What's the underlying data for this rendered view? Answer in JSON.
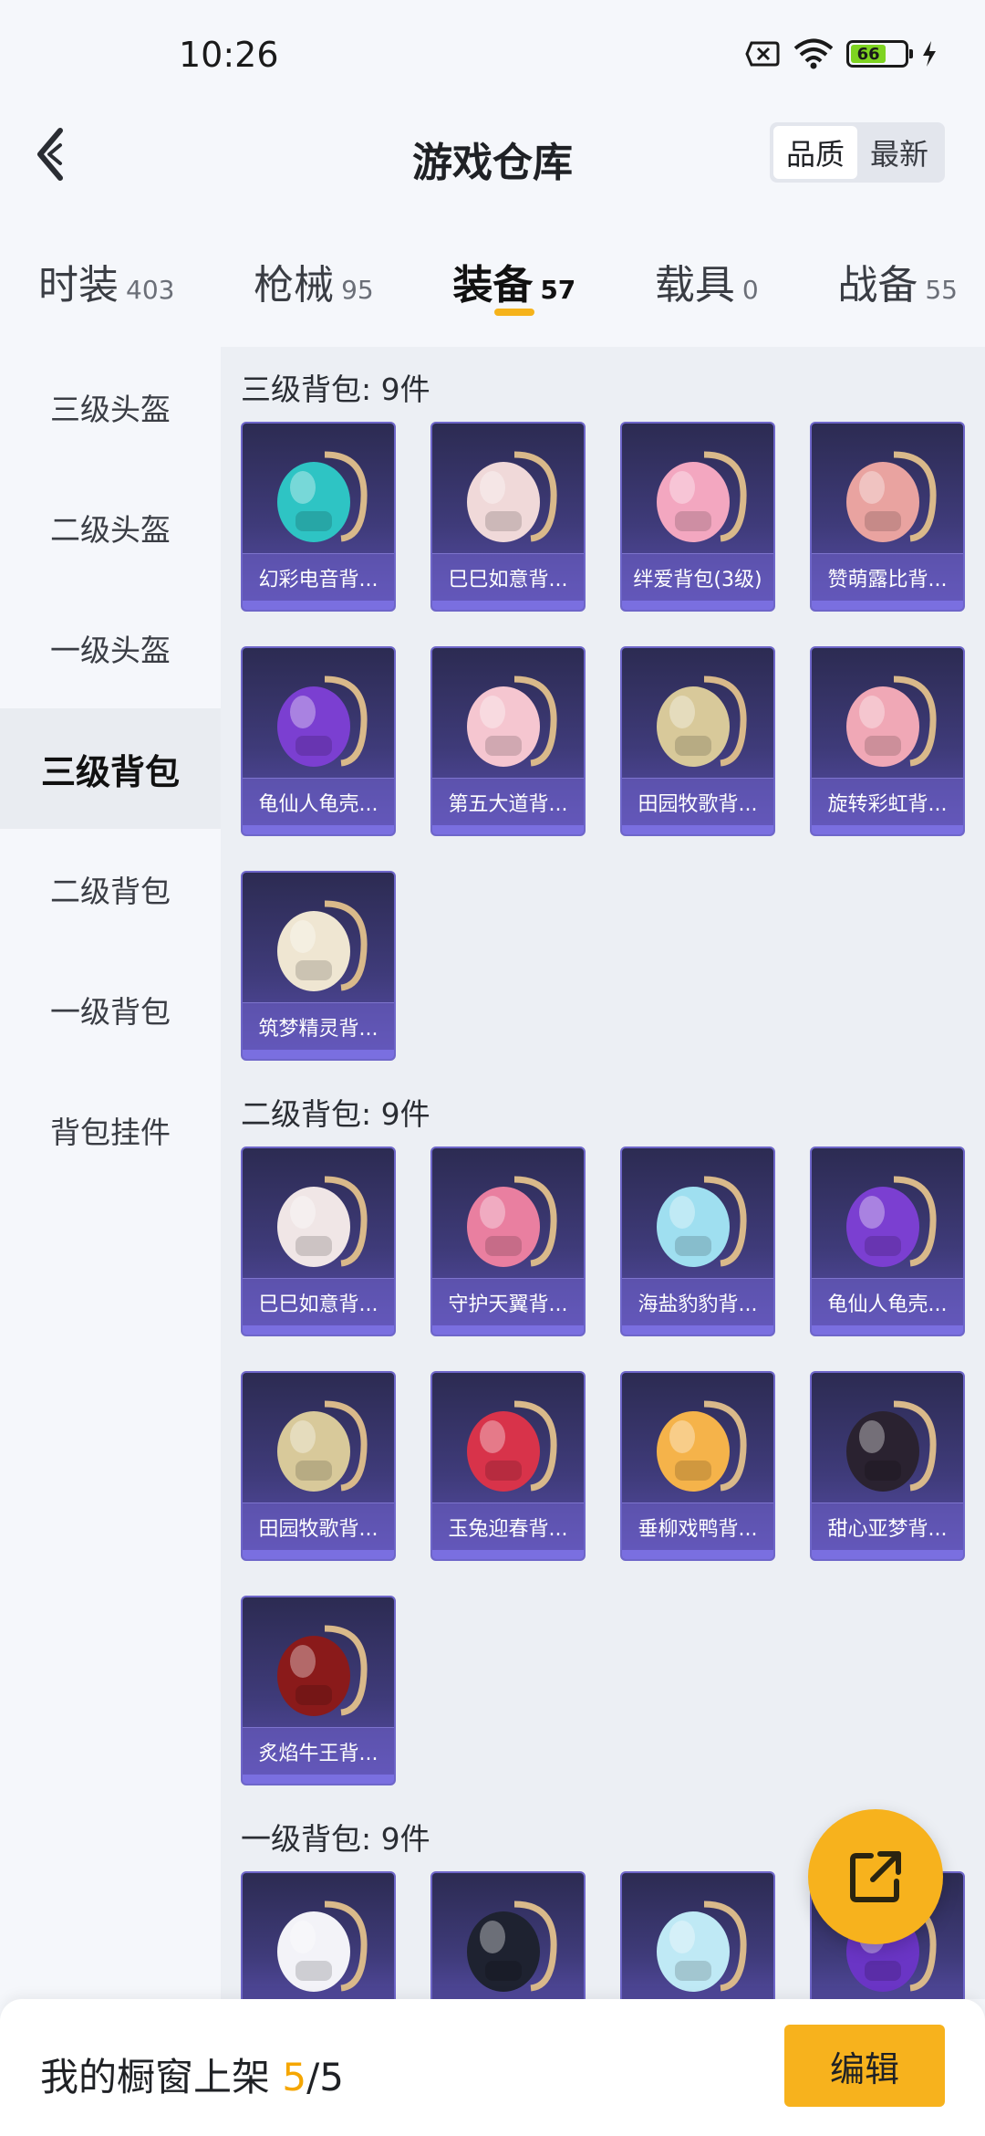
{
  "status_bar": {
    "time": "10:26",
    "battery": "66"
  },
  "header": {
    "title": "游戏仓库",
    "sort_options": [
      "品质",
      "最新"
    ],
    "active_sort": "品质"
  },
  "tabs": [
    {
      "label": "时装",
      "count": "403"
    },
    {
      "label": "枪械",
      "count": "95"
    },
    {
      "label": "装备",
      "count": "57",
      "active": true
    },
    {
      "label": "载具",
      "count": "0"
    },
    {
      "label": "战备",
      "count": "55"
    }
  ],
  "sidebar": {
    "items": [
      "三级头盔",
      "二级头盔",
      "一级头盔",
      "三级背包",
      "二级背包",
      "一级背包",
      "背包挂件"
    ],
    "active": "三级背包"
  },
  "sections": [
    {
      "title": "三级背包: 9件",
      "items": [
        {
          "name": "幻彩电音背...",
          "icon": "rainbow-music-backpack-icon",
          "color": "#2ec4c4"
        },
        {
          "name": "巳巳如意背...",
          "icon": "snake-backpack-icon",
          "color": "#f0d9d9"
        },
        {
          "name": "绊爱背包(3级)",
          "icon": "heart-backpack-icon",
          "color": "#f3a7c0"
        },
        {
          "name": "赞萌露比背...",
          "icon": "pink-bear-backpack-icon",
          "color": "#e9a3a0"
        },
        {
          "name": "龟仙人龟壳...",
          "icon": "turtle-shell-backpack-icon",
          "color": "#7b3fd1"
        },
        {
          "name": "第五大道背...",
          "icon": "quilted-bag-icon",
          "color": "#f5c6d0"
        },
        {
          "name": "田园牧歌背...",
          "icon": "flower-basket-backpack-icon",
          "color": "#d8c99a"
        },
        {
          "name": "旋转彩虹背...",
          "icon": "carousel-backpack-icon",
          "color": "#f0a8b6"
        },
        {
          "name": "筑梦精灵背...",
          "icon": "fairy-wings-backpack-icon",
          "color": "#efe6d2"
        }
      ]
    },
    {
      "title": "二级背包: 9件",
      "items": [
        {
          "name": "巳巳如意背...",
          "icon": "snake-backpack-icon",
          "color": "#f0e6e6"
        },
        {
          "name": "守护天翼背...",
          "icon": "pink-winged-backpack-icon",
          "color": "#e97fa0"
        },
        {
          "name": "海盐豹豹背...",
          "icon": "seal-backpack-icon",
          "color": "#9fdff0"
        },
        {
          "name": "龟仙人龟壳...",
          "icon": "turtle-shell-backpack-icon",
          "color": "#7b3fd1"
        },
        {
          "name": "田园牧歌背...",
          "icon": "flower-basket-backpack-icon",
          "color": "#d8c99a"
        },
        {
          "name": "玉兔迎春背...",
          "icon": "red-rabbit-backpack-icon",
          "color": "#d8334a"
        },
        {
          "name": "垂柳戏鸭背...",
          "icon": "duck-backpack-icon",
          "color": "#f5b34a"
        },
        {
          "name": "甜心亚梦背...",
          "icon": "black-heart-backpack-icon",
          "color": "#2a2230"
        },
        {
          "name": "炙焰牛王背...",
          "icon": "flame-bull-backpack-icon",
          "color": "#8a1a1a"
        }
      ]
    },
    {
      "title": "一级背包: 9件",
      "items": [
        {
          "name": "",
          "icon": "white-bunny-backpack-icon",
          "color": "#f3f3f8"
        },
        {
          "name": "",
          "icon": "black-pouch-backpack-icon",
          "color": "#1e2230"
        },
        {
          "name": "",
          "icon": "blue-seal-backpack-icon",
          "color": "#bfe9f5"
        },
        {
          "name": "",
          "icon": "purple-shell-backpack-icon",
          "color": "#6a35c5"
        }
      ]
    }
  ],
  "bottom_bar": {
    "label": "我的橱窗上架 ",
    "used": "5",
    "separator": "/",
    "total": "5",
    "edit_label": "编辑"
  }
}
